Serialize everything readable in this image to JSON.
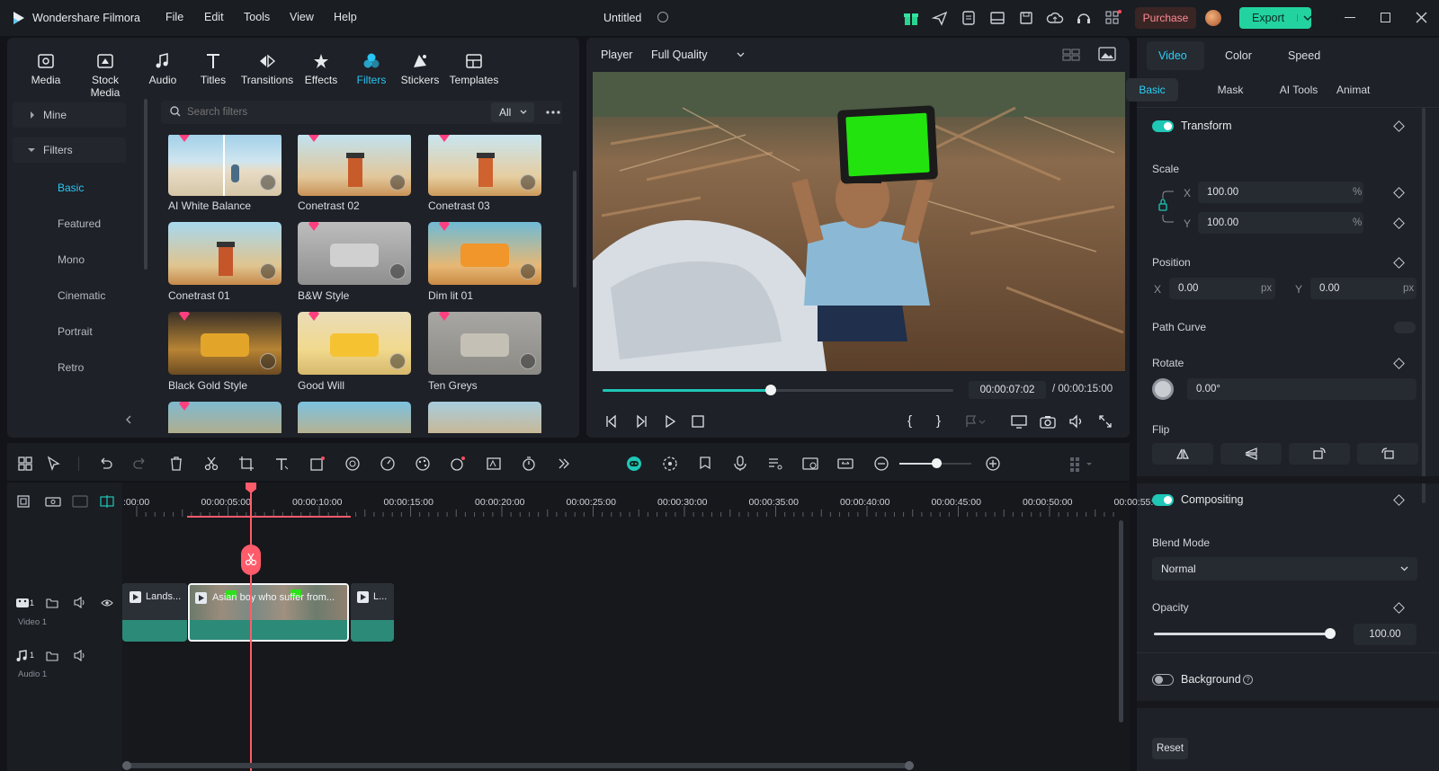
{
  "app": {
    "name": "Wondershare Filmora",
    "project_title": "Untitled"
  },
  "menu": [
    "File",
    "Edit",
    "Tools",
    "View",
    "Help"
  ],
  "titlebar": {
    "purchase_label": "Purchase",
    "export_label": "Export"
  },
  "colors": {
    "accent": "#1fc7b7",
    "export_bg": "#22d3a0",
    "purchase_bg": "#3a2525",
    "playhead": "#ff5b6a"
  },
  "toolbar": [
    "Media",
    "Stock Media",
    "Audio",
    "Titles",
    "Transitions",
    "Effects",
    "Filters",
    "Stickers",
    "Templates"
  ],
  "library": {
    "categories": [
      {
        "label": "Mine"
      },
      {
        "label": "Filters"
      }
    ],
    "subcategories": [
      "Basic",
      "Featured",
      "Mono",
      "Cinematic",
      "Portrait",
      "Retro"
    ],
    "search_placeholder": "Search filters",
    "filter_dropdown": "All",
    "items": [
      "AI White Balance",
      "Conetrast 02",
      "Conetrast 03",
      "Conetrast 01",
      "B&W Style",
      "Dim lit 01",
      "Black Gold Style",
      "Good Will",
      "Ten Greys"
    ]
  },
  "player": {
    "label": "Player",
    "quality": "Full Quality",
    "current_time": "00:00:07:02",
    "total_time": "/ 00:00:15:00",
    "progress": 0.48
  },
  "inspector": {
    "tabs": [
      "Video",
      "Color",
      "Speed"
    ],
    "subtabs": [
      "Basic",
      "Mask",
      "AI Tools",
      "Animat"
    ],
    "transform_label": "Transform",
    "scale_label": "Scale",
    "scale_x": "100.00",
    "scale_y": "100.00",
    "percent": "%",
    "position_label": "Position",
    "pos_x": "0.00",
    "pos_y": "0.00",
    "px": "px",
    "x": "X",
    "y": "Y",
    "path_curve_label": "Path Curve",
    "rotate_label": "Rotate",
    "rotate_value": "0.00°",
    "flip_label": "Flip",
    "compositing_label": "Compositing",
    "blend_mode_label": "Blend Mode",
    "blend_mode_value": "Normal",
    "opacity_label": "Opacity",
    "opacity_value": "100.00",
    "opacity_fraction": 1.0,
    "background_label": "Background",
    "reset_label": "Reset"
  },
  "timeline": {
    "ticks": [
      ":00:00",
      "00:00:05:00",
      "00:00:10:00",
      "00:00:15:00",
      "00:00:20:00",
      "00:00:25:00",
      "00:00:30:00",
      "00:00:35:00",
      "00:00:40:00",
      "00:00:45:00",
      "00:00:50:00",
      "00:00:55:"
    ],
    "tracks": {
      "video": "Video 1",
      "audio": "Audio 1",
      "video_num": "1",
      "audio_num": "1"
    },
    "clips": [
      "Lands...",
      "Asian boy who suffer from...",
      "L..."
    ]
  }
}
